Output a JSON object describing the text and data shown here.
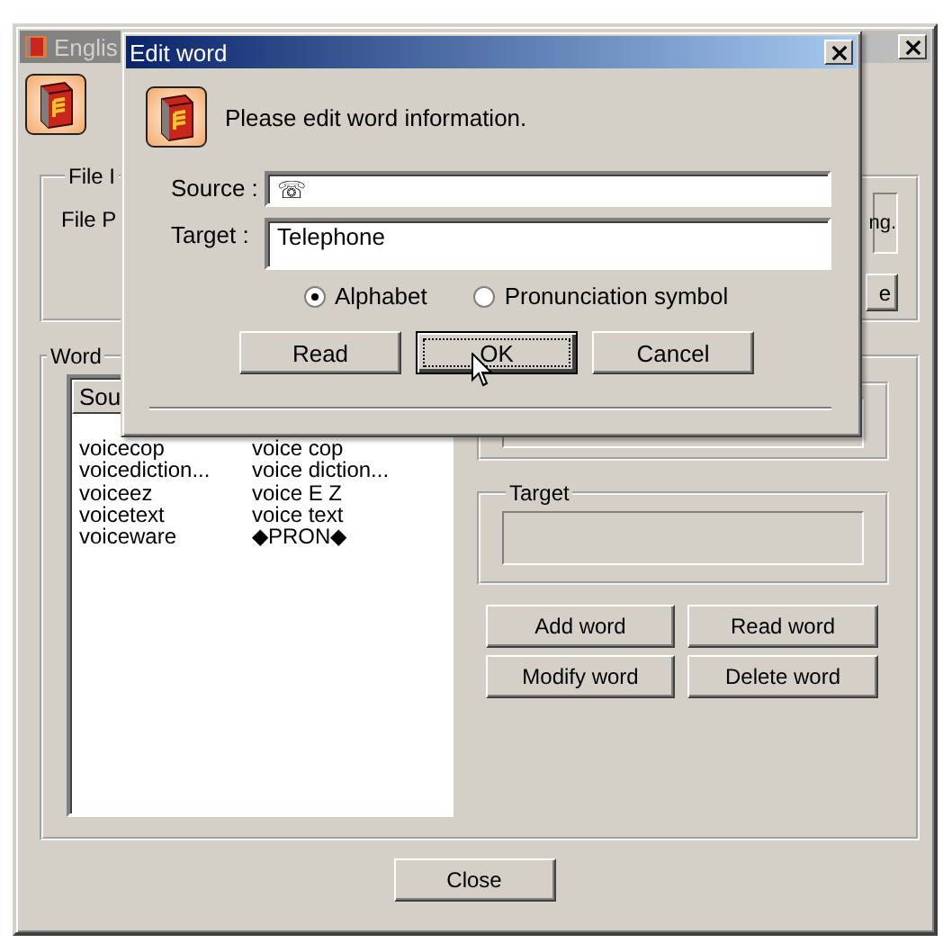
{
  "main_window": {
    "title": "Englis",
    "file_info": {
      "label": "File I",
      "file_label": "File P",
      "field_value": "ng.",
      "button": "e"
    },
    "word_group": {
      "label": "Word",
      "list": {
        "column_1": "Sou",
        "rows": [
          {
            "source": "voicecop",
            "target": "voice cop"
          },
          {
            "source": "voicediction...",
            "target": "voice diction..."
          },
          {
            "source": "voiceez",
            "target": "voice E Z"
          },
          {
            "source": "voicetext",
            "target": "voice text"
          },
          {
            "source": "voiceware",
            "target": "◆PRON◆"
          }
        ]
      },
      "target_group": {
        "label": "Target"
      },
      "buttons": [
        "Add word",
        "Read word",
        "Modify word",
        "Delete word"
      ]
    },
    "close_button": "Close"
  },
  "dialog": {
    "title": "Edit word",
    "message": "Please edit word information.",
    "source_label": "Source :",
    "source_value": "☏",
    "target_label": "Target :",
    "target_value": "Telephone",
    "options": [
      {
        "label": "Alphabet",
        "selected": true
      },
      {
        "label": "Pronunciation symbol",
        "selected": false
      }
    ],
    "buttons": [
      {
        "label": "Read",
        "default": false
      },
      {
        "label": "OK",
        "default": true
      },
      {
        "label": "Cancel",
        "default": false
      }
    ]
  }
}
